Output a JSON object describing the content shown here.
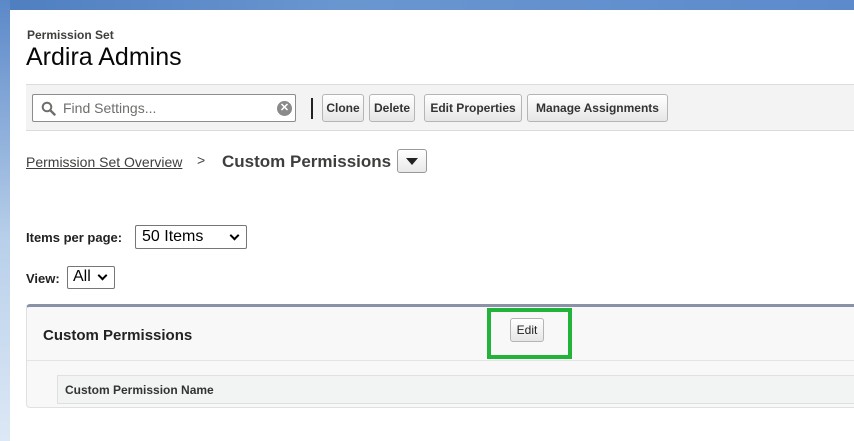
{
  "header": {
    "object_type": "Permission Set",
    "title": "Ardira Admins"
  },
  "toolbar": {
    "search_placeholder": "Find Settings...",
    "search_value": "",
    "buttons": [
      "Clone",
      "Delete",
      "Edit Properties",
      "Manage Assignments"
    ]
  },
  "breadcrumb": {
    "parent": "Permission Set Overview",
    "separator": ">",
    "current": "Custom Permissions"
  },
  "pagination": {
    "items_per_page_label": "Items per page:",
    "items_per_page_value": "50 Items",
    "view_label": "View:",
    "view_value": "All"
  },
  "panel": {
    "title": "Custom Permissions",
    "edit_label": "Edit",
    "columns": [
      "Custom Permission Name"
    ]
  },
  "colors": {
    "highlight": "#22b33a",
    "panel_accent": "#8a92a8",
    "toolbar_bg": "#f3f3f3"
  },
  "icons": [
    "search-icon",
    "clear-icon",
    "caret-down-icon",
    "chevron-down-icon"
  ]
}
